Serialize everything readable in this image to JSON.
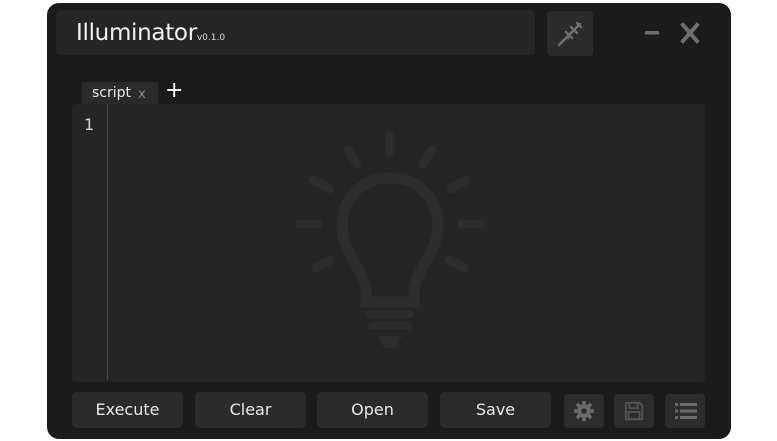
{
  "app": {
    "title": "Illuminator",
    "version": "v0.1.0"
  },
  "window_controls": {
    "minimize_icon": "minimize-icon",
    "close_icon": "close-icon"
  },
  "toolbar": {
    "inject_icon": "syringe-icon"
  },
  "tabs": [
    {
      "label": "script",
      "close": "x"
    }
  ],
  "add_tab": "+",
  "editor": {
    "line_numbers": [
      "1"
    ],
    "watermark_icon": "lightbulb-icon"
  },
  "actions": {
    "execute_label": "Execute",
    "clear_label": "Clear",
    "open_label": "Open",
    "save_label": "Save",
    "settings_icon": "gear-icon",
    "save_icon": "floppy-disk-icon",
    "list_icon": "list-icon"
  },
  "colors": {
    "window_bg": "#1b1b1b",
    "panel_bg": "#262626",
    "editor_bg": "#252525",
    "button_bg": "#2b2b2b",
    "text": "#e8e8e8",
    "icon": "#707070"
  }
}
